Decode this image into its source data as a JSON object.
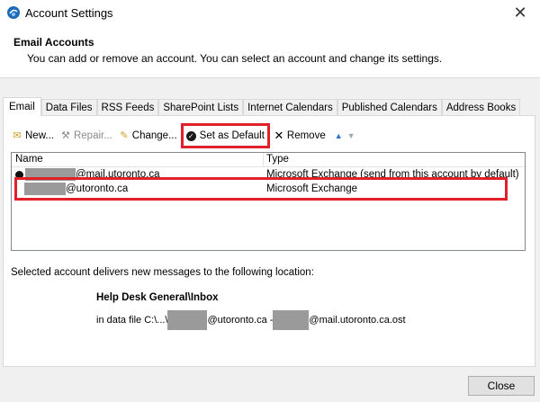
{
  "window": {
    "title": "Account Settings"
  },
  "header": {
    "title": "Email Accounts",
    "description": "You can add or remove an account. You can select an account and change its settings."
  },
  "tabs": [
    {
      "label": "Email",
      "active": true
    },
    {
      "label": "Data Files"
    },
    {
      "label": "RSS Feeds"
    },
    {
      "label": "SharePoint Lists"
    },
    {
      "label": "Internet Calendars"
    },
    {
      "label": "Published Calendars"
    },
    {
      "label": "Address Books"
    }
  ],
  "toolbar": {
    "new": "New...",
    "repair": "Repair...",
    "change": "Change...",
    "set_default": "Set as Default",
    "remove": "Remove"
  },
  "list": {
    "columns": {
      "name": "Name",
      "type": "Type"
    },
    "rows": [
      {
        "name_suffix": "@mail.utoronto.ca",
        "type": "Microsoft Exchange (send from this account by default)",
        "is_default": true
      },
      {
        "name_suffix": "@utoronto.ca",
        "type": "Microsoft Exchange",
        "is_default": false
      }
    ]
  },
  "delivery": {
    "info": "Selected account delivers new messages to the following location:",
    "folder": "Help Desk General\\Inbox",
    "datafile_prefix": "in data file C:\\...\\",
    "datafile_mid": "@utoronto.ca - ",
    "datafile_suffix": "@mail.utoronto.ca.ost"
  },
  "footer": {
    "close_label": "Close"
  },
  "colors": {
    "highlight": "#e0202a",
    "accent": "#2f6fd6"
  },
  "icons": [
    "outlook-app-icon",
    "new-icon",
    "repair-icon",
    "change-icon",
    "default-check-icon",
    "remove-icon",
    "move-up-icon",
    "move-down-icon"
  ]
}
